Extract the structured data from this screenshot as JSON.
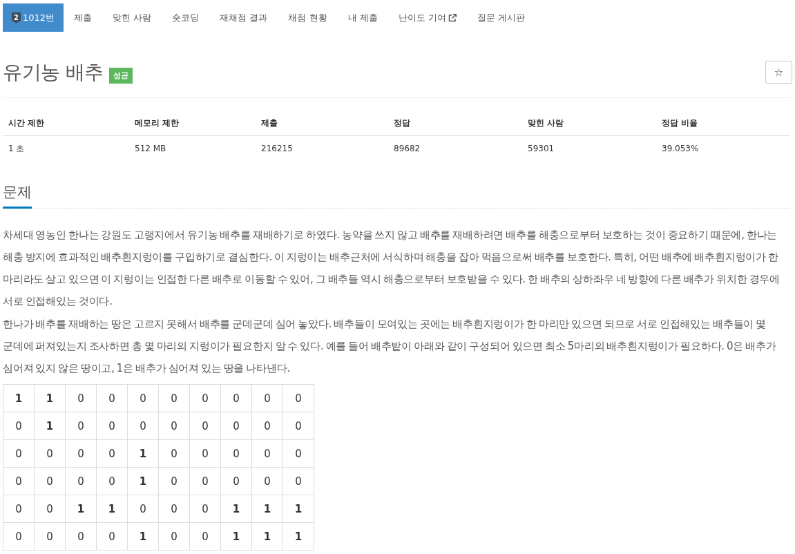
{
  "nav": {
    "tabs": [
      {
        "label": "1012번",
        "badge": "2",
        "external": false,
        "selected": true
      },
      {
        "label": "제출",
        "external": false,
        "selected": false
      },
      {
        "label": "맞힌 사람",
        "external": false,
        "selected": false
      },
      {
        "label": "숏코딩",
        "external": false,
        "selected": false
      },
      {
        "label": "재채점 결과",
        "external": false,
        "selected": false
      },
      {
        "label": "채점 현황",
        "external": false,
        "selected": false
      },
      {
        "label": "내 제출",
        "external": false,
        "selected": false
      },
      {
        "label": "난이도 기여",
        "external": true,
        "selected": false
      },
      {
        "label": "질문 게시판",
        "external": false,
        "selected": false
      }
    ]
  },
  "problem": {
    "title": "유기농 배추",
    "result_badge": "성공",
    "star_button": "☆"
  },
  "limits_table": {
    "columns": [
      "시간 제한",
      "메모리 제한",
      "제출",
      "정답",
      "맞힌 사람",
      "정답 비율"
    ],
    "rows": [
      [
        "1 초",
        "512 MB",
        "216215",
        "89682",
        "59301",
        "39.053%"
      ]
    ]
  },
  "description": {
    "heading": "문제",
    "paragraphs": [
      "차세대 영농인 한나는 강원도 고랭지에서 유기농 배추를 재배하기로 하였다. 농약을 쓰지 않고 배추를 재배하려면 배추를 해충으로부터 보호하는 것이 중요하기 때문에, 한나는 해충 방지에 효과적인 배추흰지렁이를 구입하기로 결심한다. 이 지렁이는 배추근처에 서식하며 해충을 잡아 먹음으로써 배추를 보호한다. 특히, 어떤 배추에 배추흰지렁이가 한 마리라도 살고 있으면 이 지렁이는 인접한 다른 배추로 이동할 수 있어, 그 배추들 역시 해충으로부터 보호받을 수 있다. 한 배추의 상하좌우 네 방향에 다른 배추가 위치한 경우에 서로 인접해있는 것이다.",
      "한나가 배추를 재배하는 땅은 고르지 못해서 배추를 군데군데 심어 놓았다. 배추들이 모여있는 곳에는 배추흰지렁이가 한 마리만 있으면 되므로 서로 인접해있는 배추들이 몇 군데에 퍼져있는지 조사하면 총 몇 마리의 지렁이가 필요한지 알 수 있다. 예를 들어 배추밭이 아래와 같이 구성되어 있으면 최소 5마리의 배추흰지렁이가 필요하다. 0은 배추가 심어져 있지 않은 땅이고, 1은 배추가 심어져 있는 땅을 나타낸다."
    ],
    "grid": {
      "rows": [
        [
          {
            "text": "1",
            "bold": true
          },
          {
            "text": "1",
            "bold": true
          },
          {
            "text": "0",
            "bold": false
          },
          {
            "text": "0",
            "bold": false
          },
          {
            "text": "0",
            "bold": false
          },
          {
            "text": "0",
            "bold": false
          },
          {
            "text": "0",
            "bold": false
          },
          {
            "text": "0",
            "bold": false
          },
          {
            "text": "0",
            "bold": false
          },
          {
            "text": "0",
            "bold": false
          }
        ],
        [
          {
            "text": "0",
            "bold": false
          },
          {
            "text": "1",
            "bold": true
          },
          {
            "text": "0",
            "bold": false
          },
          {
            "text": "0",
            "bold": false
          },
          {
            "text": "0",
            "bold": false
          },
          {
            "text": "0",
            "bold": false
          },
          {
            "text": "0",
            "bold": false
          },
          {
            "text": "0",
            "bold": false
          },
          {
            "text": "0",
            "bold": false
          },
          {
            "text": "0",
            "bold": false
          }
        ],
        [
          {
            "text": "0",
            "bold": false
          },
          {
            "text": "0",
            "bold": false
          },
          {
            "text": "0",
            "bold": false
          },
          {
            "text": "0",
            "bold": false
          },
          {
            "text": "1",
            "bold": true
          },
          {
            "text": "0",
            "bold": false
          },
          {
            "text": "0",
            "bold": false
          },
          {
            "text": "0",
            "bold": false
          },
          {
            "text": "0",
            "bold": false
          },
          {
            "text": "0",
            "bold": false
          }
        ],
        [
          {
            "text": "0",
            "bold": false
          },
          {
            "text": "0",
            "bold": false
          },
          {
            "text": "0",
            "bold": false
          },
          {
            "text": "0",
            "bold": false
          },
          {
            "text": "1",
            "bold": true
          },
          {
            "text": "0",
            "bold": false
          },
          {
            "text": "0",
            "bold": false
          },
          {
            "text": "0",
            "bold": false
          },
          {
            "text": "0",
            "bold": false
          },
          {
            "text": "0",
            "bold": false
          }
        ],
        [
          {
            "text": "0",
            "bold": false
          },
          {
            "text": "0",
            "bold": false
          },
          {
            "text": "1",
            "bold": true
          },
          {
            "text": "1",
            "bold": true
          },
          {
            "text": "0",
            "bold": false
          },
          {
            "text": "0",
            "bold": false
          },
          {
            "text": "0",
            "bold": false
          },
          {
            "text": "1",
            "bold": true
          },
          {
            "text": "1",
            "bold": true
          },
          {
            "text": "1",
            "bold": true
          }
        ],
        [
          {
            "text": "0",
            "bold": false
          },
          {
            "text": "0",
            "bold": false
          },
          {
            "text": "0",
            "bold": false
          },
          {
            "text": "0",
            "bold": false
          },
          {
            "text": "1",
            "bold": true
          },
          {
            "text": "0",
            "bold": false
          },
          {
            "text": "0",
            "bold": false
          },
          {
            "text": "1",
            "bold": true
          },
          {
            "text": "1",
            "bold": true
          },
          {
            "text": "1",
            "bold": true
          }
        ]
      ]
    }
  }
}
